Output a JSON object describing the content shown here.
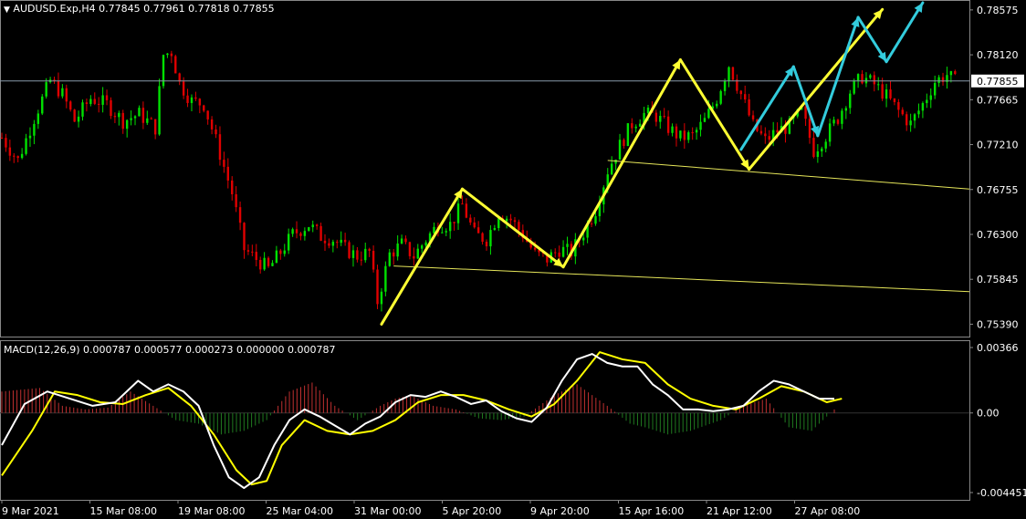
{
  "header": {
    "symbol_line": "AUDUSD.Exp,H4  0.77845 0.77961 0.77818 0.77855",
    "macd_line": "MACD(12,26,9) 0.000787 0.000577 0.000273 0.000000 0.000787"
  },
  "price_axis": {
    "ticks": [
      "0.78575",
      "0.78120",
      "0.77665",
      "0.77210",
      "0.76755",
      "0.76300",
      "0.75845",
      "0.75390"
    ],
    "current_price": "0.77855"
  },
  "macd_axis": {
    "ticks": [
      "0.00366",
      "0.00",
      "-0.004451"
    ]
  },
  "time_axis": {
    "ticks": [
      "9 Mar 2021",
      "15 Mar 08:00",
      "19 Mar 08:00",
      "25 Mar 04:00",
      "31 Mar 00:00",
      "5 Apr 20:00",
      "9 Apr 20:00",
      "15 Apr 16:00",
      "21 Apr 12:00",
      "27 Apr 08:00"
    ]
  },
  "colors": {
    "background": "#000000",
    "bull_candle": "#00e000",
    "bear_candle": "#e00000",
    "macd_main": "#ffffff",
    "macd_signal": "#ffff00",
    "hist_positive": "#c03030",
    "hist_negative": "#207a20",
    "arrow_yellow": "#ffff33",
    "arrow_cyan": "#33ccdd",
    "trendline": "#e6e65a",
    "price_line": "#8899aa"
  },
  "chart_data": {
    "type": "candlestick",
    "title": "AUDUSD.Exp,H4",
    "ohlc_last": {
      "open": 0.77845,
      "high": 0.77961,
      "low": 0.77818,
      "close": 0.77855
    },
    "price_range": [
      0.7532,
      0.7862
    ],
    "close_path": [
      [
        0,
        0.7728
      ],
      [
        4,
        0.7705
      ],
      [
        8,
        0.7748
      ],
      [
        12,
        0.7786
      ],
      [
        15,
        0.7772
      ],
      [
        18,
        0.7745
      ],
      [
        22,
        0.7768
      ],
      [
        26,
        0.7762
      ],
      [
        30,
        0.7745
      ],
      [
        34,
        0.7752
      ],
      [
        38,
        0.7738
      ],
      [
        40,
        0.7812
      ],
      [
        42,
        0.7815
      ],
      [
        44,
        0.7783
      ],
      [
        47,
        0.7765
      ],
      [
        50,
        0.7762
      ],
      [
        53,
        0.7725
      ],
      [
        57,
        0.7672
      ],
      [
        60,
        0.7615
      ],
      [
        63,
        0.7605
      ],
      [
        66,
        0.7595
      ],
      [
        69,
        0.7612
      ],
      [
        72,
        0.763
      ],
      [
        76,
        0.764
      ],
      [
        79,
        0.7628
      ],
      [
        82,
        0.7625
      ],
      [
        85,
        0.7615
      ],
      [
        88,
        0.7608
      ],
      [
        91,
        0.7612
      ],
      [
        93,
        0.7562
      ],
      [
        96,
        0.761
      ],
      [
        99,
        0.762
      ],
      [
        102,
        0.7608
      ],
      [
        105,
        0.7625
      ],
      [
        108,
        0.764
      ],
      [
        111,
        0.764
      ],
      [
        114,
        0.766
      ],
      [
        117,
        0.763
      ],
      [
        120,
        0.7625
      ],
      [
        123,
        0.7652
      ],
      [
        126,
        0.7645
      ],
      [
        129,
        0.763
      ],
      [
        132,
        0.761
      ],
      [
        135,
        0.7605
      ],
      [
        138,
        0.7615
      ],
      [
        141,
        0.7612
      ],
      [
        144,
        0.7632
      ],
      [
        147,
        0.7655
      ],
      [
        150,
        0.7695
      ],
      [
        153,
        0.772
      ],
      [
        156,
        0.7742
      ],
      [
        159,
        0.7752
      ],
      [
        162,
        0.775
      ],
      [
        165,
        0.7738
      ],
      [
        168,
        0.7728
      ],
      [
        171,
        0.773
      ],
      [
        174,
        0.7745
      ],
      [
        177,
        0.7768
      ],
      [
        180,
        0.7802
      ],
      [
        183,
        0.7772
      ],
      [
        186,
        0.774
      ],
      [
        189,
        0.7725
      ],
      [
        192,
        0.7735
      ],
      [
        195,
        0.774
      ],
      [
        198,
        0.7755
      ],
      [
        201,
        0.7715
      ],
      [
        204,
        0.773
      ],
      [
        207,
        0.7748
      ],
      [
        210,
        0.7775
      ],
      [
        213,
        0.779
      ],
      [
        216,
        0.7782
      ],
      [
        219,
        0.777
      ],
      [
        222,
        0.7755
      ],
      [
        225,
        0.7742
      ],
      [
        228,
        0.7762
      ],
      [
        231,
        0.7785
      ],
      [
        234,
        0.7792
      ],
      [
        236,
        0.7785
      ]
    ],
    "macd_range": [
      -0.004451,
      0.00366
    ],
    "macd_main": [
      [
        0,
        -0.0018
      ],
      [
        6,
        0.0005
      ],
      [
        12,
        0.0012
      ],
      [
        18,
        0.0008
      ],
      [
        24,
        0.0004
      ],
      [
        30,
        0.0006
      ],
      [
        36,
        0.0018
      ],
      [
        40,
        0.0012
      ],
      [
        44,
        0.0016
      ],
      [
        48,
        0.0012
      ],
      [
        52,
        0.0004
      ],
      [
        56,
        -0.0018
      ],
      [
        60,
        -0.0036
      ],
      [
        64,
        -0.0042
      ],
      [
        68,
        -0.0036
      ],
      [
        72,
        -0.0018
      ],
      [
        76,
        -0.0004
      ],
      [
        80,
        0.0002
      ],
      [
        84,
        -0.0002
      ],
      [
        88,
        -0.0007
      ],
      [
        92,
        -0.0012
      ],
      [
        96,
        -0.0006
      ],
      [
        100,
        -0.0002
      ],
      [
        104,
        0.0006
      ],
      [
        108,
        0.001
      ],
      [
        112,
        0.0009
      ],
      [
        116,
        0.0012
      ],
      [
        120,
        0.0009
      ],
      [
        124,
        0.0005
      ],
      [
        128,
        0.0007
      ],
      [
        132,
        0.0001
      ],
      [
        136,
        -0.0003
      ],
      [
        140,
        -0.0005
      ],
      [
        144,
        0.0003
      ],
      [
        148,
        0.0018
      ],
      [
        152,
        0.003
      ],
      [
        156,
        0.0033
      ],
      [
        160,
        0.0028
      ],
      [
        164,
        0.0026
      ],
      [
        168,
        0.0026
      ],
      [
        172,
        0.0016
      ],
      [
        176,
        0.001
      ],
      [
        180,
        0.0002
      ],
      [
        184,
        0.0002
      ],
      [
        188,
        0.0001
      ],
      [
        192,
        0.0002
      ],
      [
        196,
        0.0004
      ],
      [
        200,
        0.0012
      ],
      [
        204,
        0.0018
      ],
      [
        208,
        0.0016
      ],
      [
        212,
        0.0012
      ],
      [
        216,
        0.0008
      ],
      [
        220,
        0.0008
      ]
    ],
    "macd_signal": [
      [
        0,
        -0.0035
      ],
      [
        8,
        -0.001
      ],
      [
        14,
        0.0012
      ],
      [
        20,
        0.001
      ],
      [
        26,
        0.0006
      ],
      [
        32,
        0.0005
      ],
      [
        38,
        0.001
      ],
      [
        44,
        0.0014
      ],
      [
        50,
        0.0004
      ],
      [
        56,
        -0.0012
      ],
      [
        62,
        -0.0032
      ],
      [
        66,
        -0.004
      ],
      [
        70,
        -0.0038
      ],
      [
        74,
        -0.0018
      ],
      [
        80,
        -0.0004
      ],
      [
        86,
        -0.001
      ],
      [
        92,
        -0.0012
      ],
      [
        98,
        -0.001
      ],
      [
        104,
        -0.0004
      ],
      [
        110,
        0.0006
      ],
      [
        116,
        0.001
      ],
      [
        122,
        0.001
      ],
      [
        128,
        0.0007
      ],
      [
        134,
        0.0002
      ],
      [
        140,
        -0.0002
      ],
      [
        146,
        0.0005
      ],
      [
        152,
        0.0018
      ],
      [
        158,
        0.0034
      ],
      [
        164,
        0.003
      ],
      [
        170,
        0.0028
      ],
      [
        176,
        0.0016
      ],
      [
        182,
        0.0008
      ],
      [
        188,
        0.0004
      ],
      [
        194,
        0.0002
      ],
      [
        200,
        0.0008
      ],
      [
        206,
        0.0015
      ],
      [
        212,
        0.0012
      ],
      [
        218,
        0.0006
      ],
      [
        222,
        0.0008
      ]
    ],
    "macd_histogram": [
      [
        0,
        0.0012
      ],
      [
        10,
        0.0014
      ],
      [
        16,
        0.0004
      ],
      [
        22,
        0.0002
      ],
      [
        28,
        0.0003
      ],
      [
        34,
        0.0012
      ],
      [
        40,
        0.0004
      ],
      [
        46,
        -0.0004
      ],
      [
        52,
        -0.0006
      ],
      [
        58,
        -0.0012
      ],
      [
        64,
        -0.001
      ],
      [
        70,
        -0.0004
      ],
      [
        76,
        0.0012
      ],
      [
        82,
        0.0017
      ],
      [
        88,
        0.0004
      ],
      [
        94,
        -0.0004
      ],
      [
        100,
        0.0004
      ],
      [
        104,
        0.0008
      ],
      [
        108,
        0.001
      ],
      [
        114,
        0.0004
      ],
      [
        120,
        0.0002
      ],
      [
        126,
        -0.0003
      ],
      [
        132,
        -0.0004
      ],
      [
        138,
        -0.0002
      ],
      [
        146,
        0.001
      ],
      [
        152,
        0.0016
      ],
      [
        156,
        0.001
      ],
      [
        160,
        0.0004
      ],
      [
        166,
        -0.0006
      ],
      [
        170,
        -0.0008
      ],
      [
        176,
        -0.0012
      ],
      [
        182,
        -0.001
      ],
      [
        190,
        -0.0004
      ],
      [
        196,
        0.0004
      ],
      [
        202,
        0.0008
      ],
      [
        208,
        -0.0008
      ],
      [
        214,
        -0.001
      ],
      [
        220,
        0.0002
      ]
    ],
    "yellow_arrows": [
      [
        [
          94,
          0.7539
        ],
        [
          114,
          0.7676
        ],
        [
          139,
          0.7597
        ],
        [
          168,
          0.7807
        ],
        [
          185,
          0.7696
        ],
        [
          218,
          0.7858
        ]
      ]
    ],
    "cyan_arrows": [
      [
        [
          183,
          0.7716
        ],
        [
          196,
          0.78
        ],
        [
          202,
          0.773
        ],
        [
          212,
          0.785
        ],
        [
          219,
          0.7805
        ],
        [
          228,
          0.787
        ]
      ]
    ],
    "trendlines": [
      [
        [
          97,
          0.7598
        ],
        [
          242,
          0.7572
        ]
      ],
      [
        [
          150,
          0.7705
        ],
        [
          242,
          0.7676
        ]
      ]
    ]
  }
}
